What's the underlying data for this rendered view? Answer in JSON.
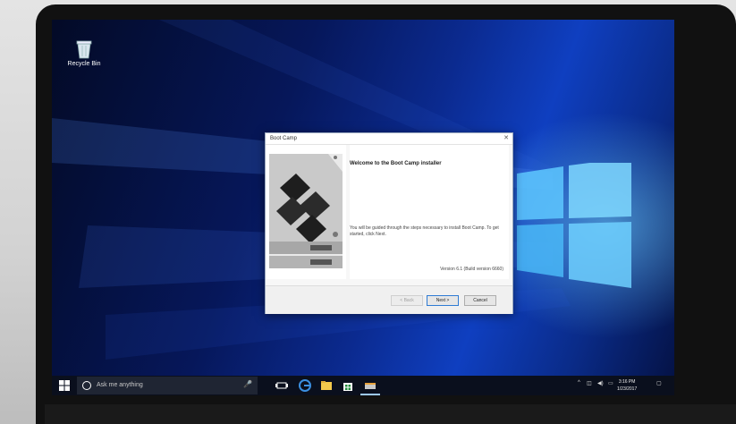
{
  "desktop": {
    "recycle_bin_label": "Recycle Bin"
  },
  "dialog": {
    "title": "Boot Camp",
    "heading": "Welcome to the Boot Camp installer",
    "body": "You will be guided through the steps necessary to install Boot Camp. To get started, click Next.",
    "version": "Version 6.1 (Build version 6660)",
    "back_label": "< Back",
    "next_label": "Next >",
    "cancel_label": "Cancel"
  },
  "taskbar": {
    "search_placeholder": "Ask me anything",
    "icons": [
      "start-icon",
      "cortana-icon",
      "microphone-icon",
      "task-view-icon",
      "edge-icon",
      "file-explorer-icon",
      "store-icon",
      "boot-camp-icon"
    ],
    "clock_time": "3:16 PM",
    "clock_date": "1/23/2017"
  },
  "colors": {
    "accent": "#2f7bd4",
    "desktop_blue": "#0b2a8f",
    "taskbar": "#0a0f1d"
  }
}
